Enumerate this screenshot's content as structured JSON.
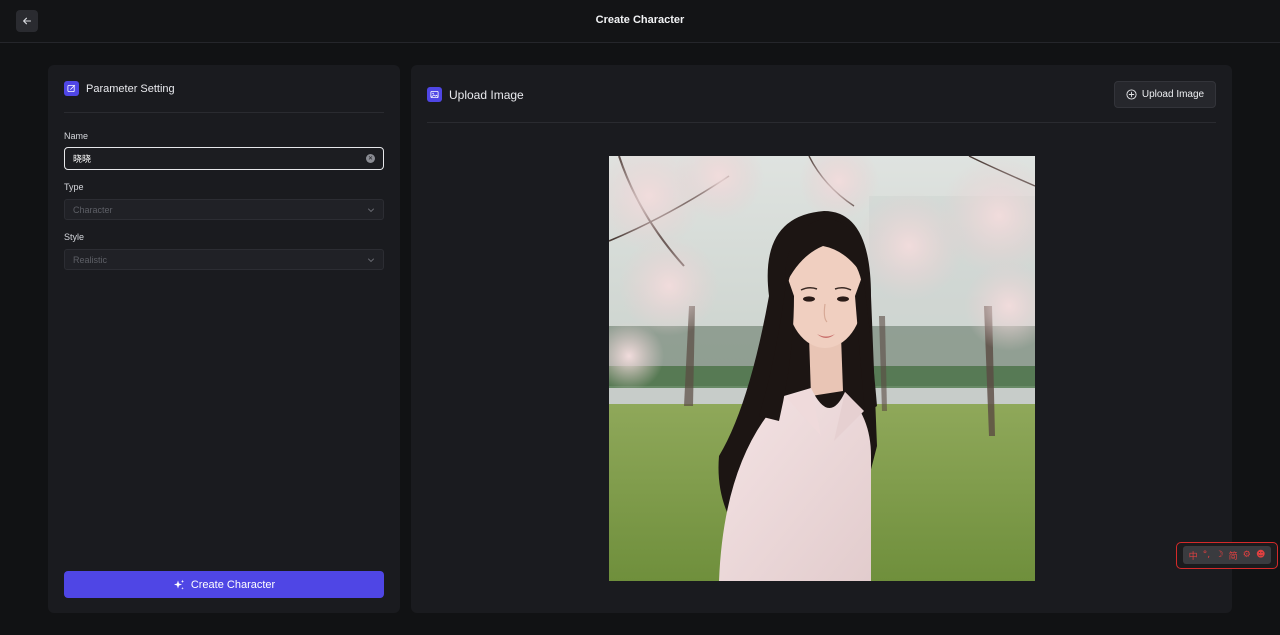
{
  "header": {
    "title": "Create Character"
  },
  "parameters": {
    "title": "Parameter Setting",
    "name_label": "Name",
    "name_value": "晓晓",
    "type_label": "Type",
    "type_value": "Character",
    "style_label": "Style",
    "style_value": "Realistic",
    "create_button": "Create Character"
  },
  "upload": {
    "title": "Upload Image",
    "button_label": "Upload Image"
  },
  "extension_toolbar": {
    "items": [
      "中",
      "°,",
      "☽",
      "简",
      "⚙",
      "☻"
    ]
  },
  "colors": {
    "accent": "#4f46e5",
    "background": "#111214",
    "panel": "#1a1b1f",
    "extension_red": "#e24040"
  }
}
